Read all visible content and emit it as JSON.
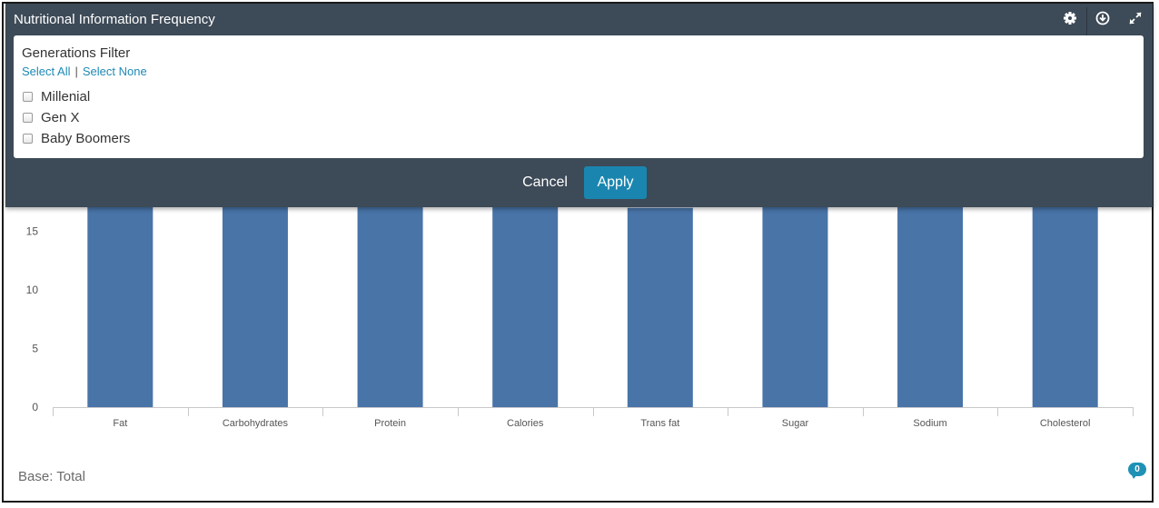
{
  "header": {
    "title": "Nutritional Information Frequency",
    "icons": [
      "gear-icon",
      "download-icon",
      "expand-icon"
    ]
  },
  "filter": {
    "title": "Generations Filter",
    "select_all": "Select All",
    "select_none": "Select None",
    "options": [
      {
        "label": "Millenial",
        "checked": false
      },
      {
        "label": "Gen X",
        "checked": false
      },
      {
        "label": "Baby Boomers",
        "checked": false
      }
    ],
    "cancel_label": "Cancel",
    "apply_label": "Apply"
  },
  "footer": {
    "base_label": "Base: Total",
    "comment_count": "0"
  },
  "colors": {
    "bar": "#4874a8",
    "overlay": "#3d4a57",
    "accent": "#1a86b0"
  },
  "chart_data": {
    "type": "bar",
    "categories": [
      "Fat",
      "Carbohydrates",
      "Protein",
      "Calories",
      "Trans fat",
      "Sugar",
      "Sodium",
      "Cholesterol"
    ],
    "values": [
      20,
      20,
      20,
      20,
      17,
      20,
      20,
      20
    ],
    "yticks": [
      0,
      5,
      10,
      15
    ],
    "ylim": [
      0,
      20
    ],
    "title": "",
    "xlabel": "",
    "ylabel": ""
  }
}
